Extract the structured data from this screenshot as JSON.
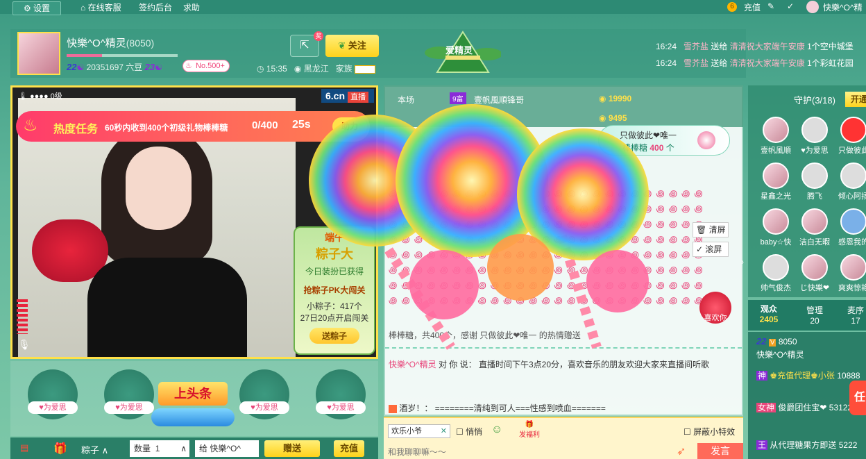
{
  "topbar": {
    "settings": "设置",
    "service": "在线客服",
    "sign_backend": "签约后台",
    "help": "求助",
    "recharge": "充值",
    "user_name": "快樂^O^精"
  },
  "anchor": {
    "name": "快樂^O^精灵",
    "room_id": "(8050)",
    "level": "22",
    "beans": "20351697 六豆",
    "wealth_level": "23",
    "rank": "No.500+",
    "time": "15:35",
    "region": "黑龙江",
    "family": "家族",
    "follow": "关注",
    "share_badge": "奖",
    "level_progress": 0.32
  },
  "zongzi_label": "爱精灵",
  "gift_feed": [
    {
      "time": "16:24",
      "user": "雪芥盐",
      "action": "送给",
      "target": "清清祝大家端午安康",
      "gift": "1个空中城堡"
    },
    {
      "time": "16:24",
      "user": "雪芥盐",
      "action": "送给",
      "target": "清清祝大家端午安康",
      "gift": "1个彩虹花园"
    }
  ],
  "video": {
    "hot_level": "0级",
    "brand": "6.cn",
    "live": "直播",
    "task_title": "热度任务",
    "task_desc": "60秒内收到400个初级礼物棒棒糖",
    "task_progress": "0/400",
    "task_time": "25s",
    "task_btn": "助力"
  },
  "dragon_panel": {
    "title": "端午",
    "subtitle": "粽子大",
    "got": "今日装扮已获得",
    "pk": "抢粽子PK大闯关",
    "count": "小粽子：417个",
    "open_time": "27日20点开启闯关",
    "btn": "送粽子"
  },
  "mid_top": {
    "rank_label": "本场",
    "user": "壹帆風順",
    "user_suffix": "锋哥",
    "user_level": "9富",
    "score1": "19990",
    "score2": "9495"
  },
  "gift_popup": {
    "title": "只做彼此❤唯一",
    "gift": "棒棒糖",
    "count": "400",
    "unit": "个"
  },
  "side_tools": {
    "clear": "清屏",
    "scroll": "滚屏"
  },
  "love_badge": "喜欢你",
  "gift_summary": "棒棒糖，共400个，感谢  只做彼此❤唯一  的热情赠送",
  "chat": [
    {
      "name": "快樂^O^精灵",
      "to": "对 你 说：",
      "text": "直播时间下午3点20分，喜欢音乐的朋友欢迎大家来直播间听歌"
    },
    {
      "name": "",
      "to": "酒岁！：",
      "text": "========清纯到可人===性感到喷血======="
    }
  ],
  "input_area": {
    "quick_user": "欢乐小爷",
    "whisper": "悄悄",
    "welfare": "发福利",
    "hide_effects": "屏蔽小特效",
    "placeholder": "和我聊聊嘛～～",
    "send": "发言"
  },
  "guard": {
    "title": "守护(3/18)",
    "open": "开通",
    "members": [
      {
        "name": "壹帆風順"
      },
      {
        "name": "♥为爱思"
      },
      {
        "name": "只做彼此"
      },
      {
        "name": "星鑫之光"
      },
      {
        "name": "腾飞"
      },
      {
        "name": "倾心阿扬"
      },
      {
        "name": "baby☆快"
      },
      {
        "name": "洁白无暇"
      },
      {
        "name": "感恩我的"
      },
      {
        "name": "帅气俊杰"
      },
      {
        "name": "じ快樂❤"
      },
      {
        "name": "爽爽惊艳"
      }
    ]
  },
  "audience": {
    "viewers_label": "观众",
    "viewers": "2405",
    "admins_label": "管理",
    "admins": "20",
    "wheat_label": "麦序",
    "wheat": "17",
    "list": [
      {
        "level": "22",
        "name": "快樂^O^精灵",
        "id": "8050"
      },
      {
        "level": "神",
        "name": "♚充值代理♚小张",
        "id": "10888"
      },
      {
        "level": "女神",
        "name": "俊爵团住宝❤",
        "id": "53122"
      },
      {
        "level": "王",
        "name": "从代理糖果方即送",
        "id": "5222"
      }
    ]
  },
  "bottom_slots": [
    {
      "name": "♥为爱思"
    },
    {
      "name": "♥为爱思"
    },
    {
      "name": "♥为爱思"
    },
    {
      "name": "♥为爱思"
    }
  ],
  "headline": "上头条",
  "bottombar": {
    "zongzi": "粽子",
    "qty_label": "数量",
    "qty": "1",
    "to_label": "给",
    "to": "快樂^O^",
    "send": "赠送",
    "recharge": "充值"
  }
}
